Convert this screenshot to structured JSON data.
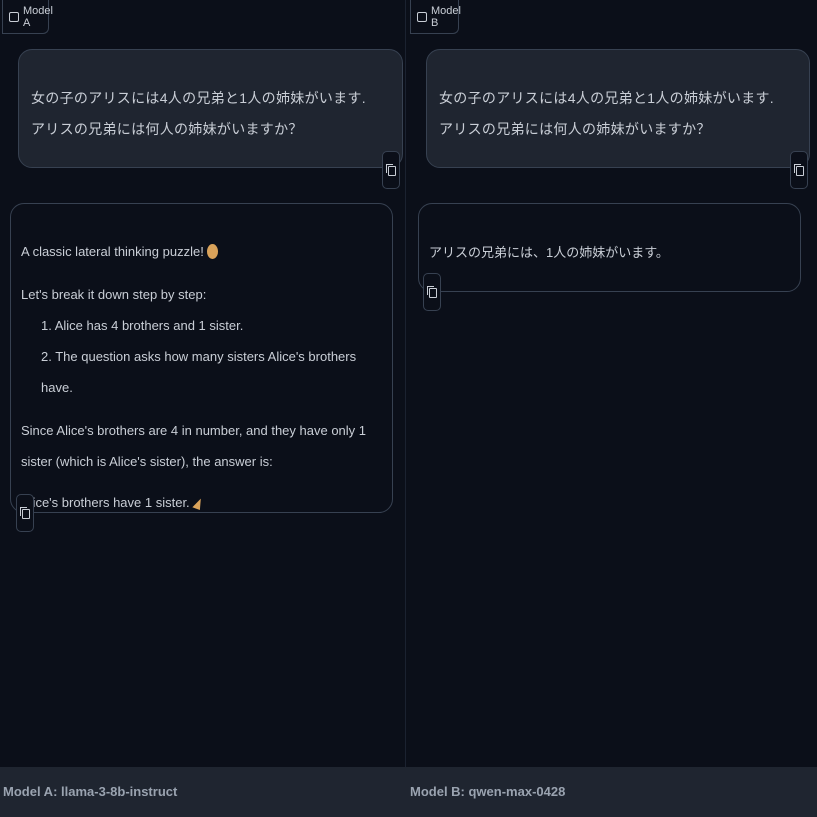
{
  "panels": {
    "a": {
      "label": "Model A",
      "user_message": "女の子のアリスには4人の兄弟と1人の姉妹がいます. アリスの兄弟には何人の姉妹がいますか？",
      "response": {
        "intro": "A classic lateral thinking puzzle! ",
        "intro_emoji": "thinking-face-icon",
        "step_intro": "Let's break it down step by step:",
        "steps": [
          "1. Alice has 4 brothers and 1 sister.",
          "2. The question asks how many sisters Alice's brothers have."
        ],
        "reasoning": "Since Alice's brothers are 4 in number, and they have only 1 sister (which is Alice's sister), the answer is:",
        "answer": "Alice's brothers have 1 sister. ",
        "answer_emoji": "party-popper-icon"
      },
      "footer": "Model A: llama-3-8b-instruct"
    },
    "b": {
      "label": "Model B",
      "user_message": "女の子のアリスには4人の兄弟と1人の姉妹がいます. アリスの兄弟には何人の姉妹がいますか？",
      "response": {
        "text": "アリスの兄弟には、1人の姉妹がいます。"
      },
      "footer": "Model B: qwen-max-0428"
    }
  },
  "colors": {
    "background": "#0b0f19",
    "bubble_user": "#1f2530",
    "border": "#374151",
    "text": "#c9ced6"
  }
}
